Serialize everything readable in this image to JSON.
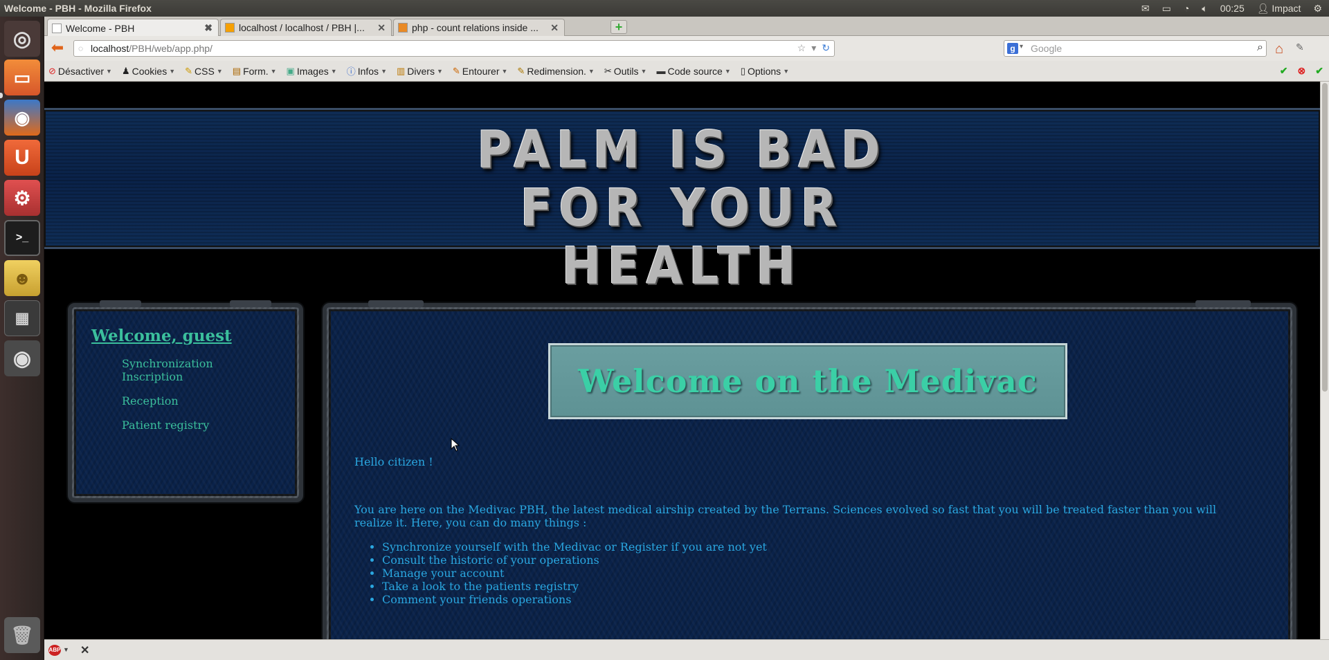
{
  "system": {
    "window_title": "Welcome - PBH - Mozilla Firefox",
    "clock": "00:25",
    "user": "Impact"
  },
  "browser": {
    "tabs": [
      {
        "label": "Welcome - PBH",
        "active": true
      },
      {
        "label": "localhost / localhost / PBH |...",
        "active": false
      },
      {
        "label": "php - count relations inside ...",
        "active": false
      }
    ],
    "url_host": "localhost",
    "url_path": "/PBH/web/app.php/",
    "search_placeholder": "Google",
    "devbar": [
      {
        "label": "Désactiver",
        "icon": "disable-icon"
      },
      {
        "label": "Cookies",
        "icon": "cookies-icon"
      },
      {
        "label": "CSS",
        "icon": "css-icon"
      },
      {
        "label": "Form.",
        "icon": "forms-icon"
      },
      {
        "label": "Images",
        "icon": "images-icon"
      },
      {
        "label": "Infos",
        "icon": "info-icon"
      },
      {
        "label": "Divers",
        "icon": "misc-icon"
      },
      {
        "label": "Entourer",
        "icon": "outline-icon"
      },
      {
        "label": "Redimension.",
        "icon": "resize-icon"
      },
      {
        "label": "Outils",
        "icon": "tools-icon"
      },
      {
        "label": "Code source",
        "icon": "source-icon"
      },
      {
        "label": "Options",
        "icon": "options-icon"
      }
    ]
  },
  "page": {
    "site_title": "PALM IS BAD FOR YOUR HEALTH",
    "sidebar": {
      "title": "Welcome, guest",
      "links": [
        "Synchronization",
        "Inscription",
        "Reception",
        "Patient registry"
      ]
    },
    "welcome_banner": "Welcome on the Medivac",
    "greeting": "Hello citizen !",
    "intro": "You are here on the Medivac PBH, the latest medical airship created by the Terrans. Sciences evolved so fast that you will be treated faster than you will realize it. Here, you can do many things :",
    "features": [
      "Synchronize yourself with the Medivac or Register if you are not yet",
      "Consult the historic of your operations",
      "Manage your account",
      "Take a look to the patients registry",
      "Comment your friends operations"
    ]
  },
  "colors": {
    "link_green": "#3bbf9c",
    "text_blue": "#2aa7e0",
    "panel_navy": "#0a2249",
    "banner_teal": "#6a9ea0"
  }
}
